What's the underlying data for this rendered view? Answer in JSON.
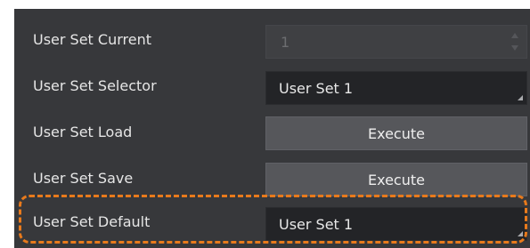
{
  "rows": [
    {
      "label": "User Set Current",
      "value": "1"
    },
    {
      "label": "User Set Selector",
      "value": "User Set 1"
    },
    {
      "label": "User Set Load",
      "value": "Execute"
    },
    {
      "label": "User Set Save",
      "value": "Execute"
    },
    {
      "label": "User Set Default",
      "value": "User Set 1"
    }
  ],
  "icons": {
    "spin_up": "triangle-up-icon",
    "spin_down": "triangle-down-icon",
    "dropdown_corner": "corner-triangle-icon"
  },
  "colors": {
    "panel_background": "#37383b",
    "highlight_border": "#e87a1c"
  }
}
